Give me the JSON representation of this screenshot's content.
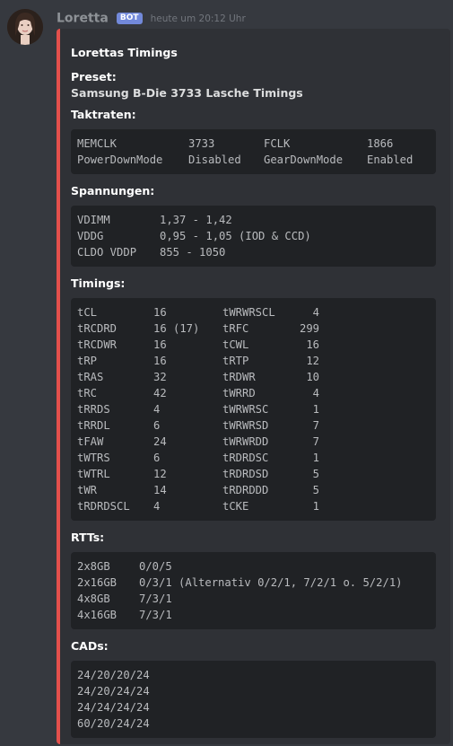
{
  "message": {
    "author": "Loretta",
    "bot_tag": "BOT",
    "timestamp": "heute um 20:12 Uhr"
  },
  "embed": {
    "accent_color": "#e3504c",
    "title": "Lorettas Timings",
    "preset_label": "Preset:",
    "preset_value": "Samsung B-Die 3733 Lasche Timings",
    "taktraten": {
      "label": "Taktraten:",
      "rows": [
        [
          "MEMCLK",
          "3733",
          "FCLK",
          "1866"
        ],
        [
          "PowerDownMode",
          "Disabled",
          "GearDownMode",
          "Enabled"
        ]
      ]
    },
    "spannungen": {
      "label": "Spannungen:",
      "rows": [
        [
          "VDIMM",
          "1,37 - 1,42"
        ],
        [
          "VDDG",
          "0,95 - 1,05 (IOD & CCD)"
        ],
        [
          "CLDO VDDP",
          "855 - 1050"
        ]
      ]
    },
    "timings": {
      "label": "Timings:",
      "rows": [
        [
          "tCL",
          "16",
          "tWRWRSCL",
          "4"
        ],
        [
          "tRCDRD",
          "16 (17)",
          "tRFC",
          "299"
        ],
        [
          "tRCDWR",
          "16",
          "tCWL",
          "16"
        ],
        [
          "tRP",
          "16",
          "tRTP",
          "12"
        ],
        [
          "tRAS",
          "32",
          "tRDWR",
          "10"
        ],
        [
          "tRC",
          "42",
          "tWRRD",
          "4"
        ],
        [
          "tRRDS",
          "4",
          "tWRWRSC",
          "1"
        ],
        [
          "tRRDL",
          "6",
          "tWRWRSD",
          "7"
        ],
        [
          "tFAW",
          "24",
          "tWRWRDD",
          "7"
        ],
        [
          "tWTRS",
          "6",
          "tRDRDSC",
          "1"
        ],
        [
          "tWTRL",
          "12",
          "tRDRDSD",
          "5"
        ],
        [
          "tWR",
          "14",
          "tRDRDDD",
          "5"
        ],
        [
          "tRDRDSCL",
          "4",
          "tCKE",
          "1"
        ]
      ]
    },
    "rtts": {
      "label": "RTTs:",
      "rows": [
        [
          "2x8GB",
          "0/0/5"
        ],
        [
          "2x16GB",
          "0/3/1 (Alternativ 0/2/1, 7/2/1 o. 5/2/1)"
        ],
        [
          "4x8GB",
          "7/3/1"
        ],
        [
          "4x16GB",
          "7/3/1"
        ]
      ]
    },
    "cads": {
      "label": "CADs:",
      "rows": [
        "24/20/20/24",
        "24/20/24/24",
        "24/24/24/24",
        "60/20/24/24"
      ]
    }
  }
}
